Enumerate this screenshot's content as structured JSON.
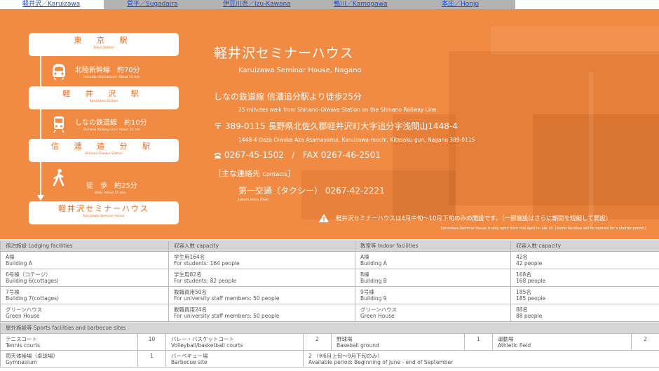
{
  "tabs": [
    {
      "label": "軽井沢／Karuizawa",
      "active": true
    },
    {
      "label": "菅平／Sugadaira",
      "active": false
    },
    {
      "label": "伊豆川奈／Izu-Kawana",
      "active": false
    },
    {
      "label": "鴨川／Kamogawa",
      "active": false
    },
    {
      "label": "本庄／Honjo",
      "active": false
    }
  ],
  "colors": {
    "accent": "#f18a42",
    "text_orange": "#ee6c1f",
    "tab_link": "#1a4fd6"
  },
  "route": {
    "stations": [
      {
        "ja": "東 京 駅",
        "en": "Tokyo Station"
      },
      {
        "ja": "軽 井 沢 駅",
        "en": "Karuizawa Station"
      },
      {
        "ja": "信 濃 追 分 駅",
        "en": "Shinano-Oiwake Station"
      },
      {
        "ja": "軽井沢セミナーハウス",
        "en": "Karuizawa Seminar House"
      }
    ],
    "legs": [
      {
        "icon": "bullet-train-icon",
        "ja": "北陸新幹線　約70分",
        "en": "Hokuriku Shinkansen: About 70 min."
      },
      {
        "icon": "train-icon",
        "ja": "しなの鉄道線　約10分",
        "en": "Shinano Railway Line: About 10 min."
      },
      {
        "icon": "walking-person-icon",
        "ja": "徒　歩　約25分",
        "en": "Walk: About 25 min."
      }
    ]
  },
  "info": {
    "title_ja_a": "軽井沢",
    "title_ja_b": "セミナーハウス",
    "title_en": "Karuizawa Seminar House, Nagano",
    "access_ja": "しなの鉄道線 信濃追分駅より徒歩25分",
    "access_en": "25 minutes walk from Shinano-Oiwake Station on the Shinano Railway Line.",
    "address_ja": "〒 389-0115 長野県北佐久郡軽井沢町大字追分字浅間山1448-4",
    "address_en": "1448-4 Oaza Oiwake Aza Asamayama, Karuizawa-machi, Kitasaku-gun, Nagano 389-0115",
    "tel_icon": "phone-icon",
    "tel": "0267-45-1502",
    "fax": "FAX 0267-46-2501",
    "contacts_label": "［主な連絡先",
    "contacts_label_en": "Contacts",
    "contacts_close": "］",
    "taxi_ja": "第一交通（タクシー） 0267-42-2221",
    "taxi_en": "Daiichi Kotsu (Taxi)",
    "notice_icon": "warning-icon",
    "notice_ja": "軽井沢セミナーハウスは4月中旬～10月下旬のみの開設です。（一部施設はさらに期間を短縮して開設）",
    "notice_en": "Karuizawa Seminar House is only open from mid April to late 10. (Some facilities will be opened for a shorter period.)"
  },
  "lodging": {
    "headers": [
      "宿泊施設 Lodging facilities",
      "収容人数 capacity",
      "教室等 Indoor facilities",
      "収容人数 capacity"
    ],
    "rows": [
      [
        "A棟",
        "Building A",
        "学生用164名",
        "For students: 164 people",
        "A棟",
        "Building A",
        "42名",
        "42 people"
      ],
      [
        "6号棟（コテージ）",
        "Building 6(cottages)",
        "学生用82名",
        "For students: 82 people",
        "B棟",
        "Building B",
        "168名",
        "168 people"
      ],
      [
        "7号棟",
        "Building 7(cottages)",
        "教職員用50名",
        "For university staff members: 50 people",
        "9号棟",
        "Building 9",
        "185名",
        "185 people"
      ],
      [
        "グリーンハウス",
        "Green House",
        "教職員用24名",
        "For university staff members: 50 people",
        "グリーンハウス",
        "Green House",
        "88名",
        "88 people"
      ]
    ]
  },
  "sports": {
    "header": "屋外施設等 Sports facilities and barbecue sites",
    "row1": [
      {
        "ja": "テニスコート",
        "en": "Tennis courts",
        "count": "10"
      },
      {
        "ja": "バレー・バスケットコート",
        "en": "Volleyball/basketball courts",
        "count": "2"
      },
      {
        "ja": "野球場",
        "en": "Baseball ground",
        "count": "1"
      },
      {
        "ja": "運動場",
        "en": "Athletic field",
        "count": "2"
      }
    ],
    "row2": [
      {
        "ja": "雨天体操場（卓球場）",
        "en": "Gymnasium",
        "count": "1"
      },
      {
        "ja": "バーベキュー場",
        "en": "Barbecue site"
      }
    ],
    "bbq_note_ja": "2 （※6月上旬～9月下旬のみ）",
    "bbq_note_en": "Available period: Beginning of June - end of September"
  }
}
